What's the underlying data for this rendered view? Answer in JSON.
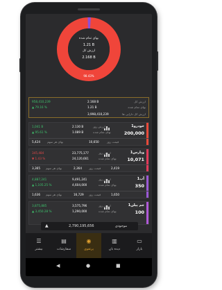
{
  "portfolio": {
    "donut": {
      "label_finished": "بهای تمام شده",
      "finished_value": "1.21 B",
      "label_total": "ارزش کل",
      "total_value": "2.168 B",
      "percent": "98.43%",
      "ring_color": "#f0453a",
      "accent_color": "#8e4fd6"
    },
    "summary": {
      "total_value_label": "ارزش کل",
      "total_value": "2.168 B",
      "cost_label": "بهای تمام شده",
      "cost_value": "1.21 B",
      "profit": "958,410,239",
      "profit_pct": "▲ 79.16 %",
      "hidden_label": "ارزش کل دارایی ها",
      "hidden_value": "3,998,410,239"
    },
    "stocks": [
      {
        "name": "خودرو1",
        "count": "200,000",
        "today_price_label": "ارزش روز",
        "today_price": "2.130 B",
        "cost_label": "بهای تمام شده",
        "cost": "1.089 B",
        "profit": "1,041 B",
        "profit_pct": "▲ 95.61 %",
        "profit_color": "green",
        "last_label": "قیمت روز",
        "last_price": "5,424",
        "avg_label": "بهای هر سهم",
        "avg_price": "10,650",
        "bar_color": "#e84a3a"
      },
      {
        "name": "وپارس1",
        "count": "10,071",
        "today_price_label": "ارزش روز",
        "today_price": "23,775,177",
        "cost_label": "بهای تمام شده",
        "cost": "24,120,661",
        "profit": "345,484",
        "profit_pct": "▼ 1.43 %",
        "profit_color": "red",
        "last_label": "قیمت روز",
        "last_price": "3,365",
        "avg_label": "بهای هر سهم",
        "avg_price": "2,364",
        "extra_label": "قیمت روز",
        "extra_price": "2,419",
        "bar_color": "#e23a5a"
      },
      {
        "name": "آپ1",
        "count": "350",
        "today_price_label": "ارزش روز",
        "today_price": "9,491,241",
        "cost_label": "بهای تمام شده",
        "cost": "4,604,000",
        "profit": "4,887,241",
        "profit_pct": "▲ 1,105.25 %",
        "profit_color": "green",
        "last_label": "قیمت روز",
        "last_price": "1,636",
        "avg_label": "بهای هر سهم",
        "avg_price": "16,729",
        "extra_label": "قیمت روز",
        "extra_price": "1,650",
        "bar_color": "#9b59d6"
      },
      {
        "name": "جم پیلن1",
        "count": "100",
        "today_price_label": "ارزش روز",
        "today_price": "3,575,796",
        "cost_label": "بهای تمام شده",
        "cost": "1,290,000",
        "profit": "3,875,885",
        "profit_pct": "▲ 3,450.28 %",
        "profit_color": "green",
        "last_label": "قیمت روز",
        "last_price": "",
        "avg_label": "",
        "avg_price": "",
        "bar_color": "#b05ad8"
      }
    ]
  },
  "floatbar": {
    "label": "موجودی",
    "value": "2,790,195,656"
  },
  "tabs": [
    {
      "label": "بازار",
      "icon": "▭"
    },
    {
      "label": "دیده بان",
      "icon": "▥"
    },
    {
      "label": "پرتفوی",
      "icon": "◉"
    },
    {
      "label": "سفارشات",
      "icon": "▤"
    },
    {
      "label": "بیشتر",
      "icon": "☰"
    }
  ]
}
